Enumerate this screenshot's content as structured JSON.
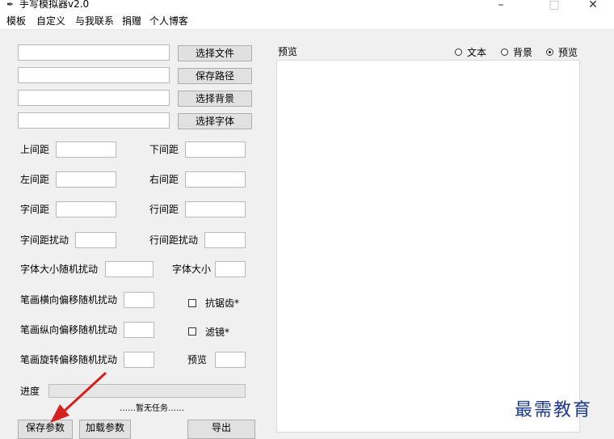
{
  "window": {
    "title": "手写模拟器v2.0",
    "minimize": "–",
    "maximize": "□",
    "close": "✕"
  },
  "menu": [
    "模板",
    "自定义",
    "与我联系",
    "捐赠",
    "个人博客"
  ],
  "file_rows": [
    {
      "value": "",
      "button": "选择文件"
    },
    {
      "value": "",
      "button": "保存路径"
    },
    {
      "value": "",
      "button": "选择背景"
    },
    {
      "value": "",
      "button": "选择字体"
    }
  ],
  "params": {
    "top_margin": {
      "label": "上间距",
      "value": ""
    },
    "bottom_margin": {
      "label": "下间距",
      "value": ""
    },
    "left_margin": {
      "label": "左间距",
      "value": ""
    },
    "right_margin": {
      "label": "右间距",
      "value": ""
    },
    "char_spacing": {
      "label": "字间距",
      "value": ""
    },
    "line_spacing": {
      "label": "行间距",
      "value": ""
    },
    "char_spacing_jitter": {
      "label": "字间距扰动",
      "value": ""
    },
    "line_spacing_jitter": {
      "label": "行间距扰动",
      "value": ""
    },
    "font_size_jitter": {
      "label": "字体大小随机扰动",
      "value": ""
    },
    "font_size": {
      "label": "字体大小",
      "value": ""
    },
    "stroke_h_offset": {
      "label": "笔画横向偏移随机扰动",
      "value": ""
    },
    "stroke_v_offset": {
      "label": "笔画纵向偏移随机扰动",
      "value": ""
    },
    "stroke_rotate": {
      "label": "笔画旋转偏移随机扰动",
      "value": ""
    },
    "preview_num": {
      "label": "预览",
      "value": ""
    }
  },
  "checkboxes": {
    "antialias": {
      "label": "抗锯齿*",
      "checked": false
    },
    "filter": {
      "label": "滤镜*",
      "checked": false
    }
  },
  "progress": {
    "label": "进度",
    "value": 0,
    "status": "……暂无任务……"
  },
  "buttons": {
    "save_params": "保存参数",
    "load_params": "加载参数",
    "export": "导出"
  },
  "preview": {
    "label": "预览",
    "modes": [
      {
        "label": "文本",
        "selected": false
      },
      {
        "label": "背景",
        "selected": false
      },
      {
        "label": "预览",
        "selected": true
      }
    ]
  },
  "watermark": "最需教育",
  "colors": {
    "arrow": "#d62020",
    "progress_fill": "#06b025",
    "watermark": "#1e3a8a"
  }
}
